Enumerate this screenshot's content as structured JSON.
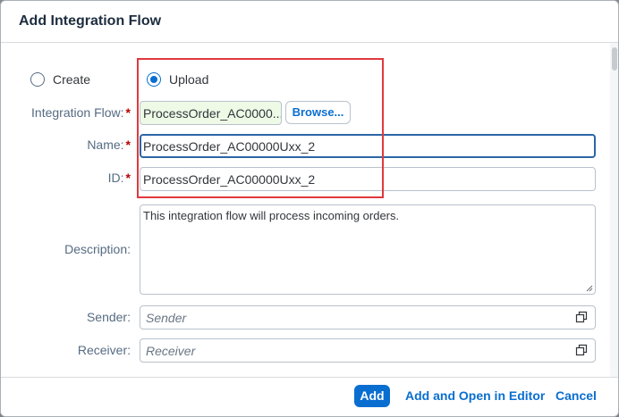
{
  "dialog": {
    "title": "Add Integration Flow"
  },
  "mode": {
    "options": [
      {
        "label": "Create",
        "checked": false
      },
      {
        "label": "Upload",
        "checked": true
      }
    ]
  },
  "form": {
    "integration_flow": {
      "label": "Integration Flow:",
      "required": "*",
      "value": "ProcessOrder_AC0000...",
      "browse_label": "Browse..."
    },
    "name": {
      "label": "Name:",
      "required": "*",
      "value": "ProcessOrder_AC00000Uxx_2"
    },
    "id": {
      "label": "ID:",
      "required": "*",
      "value": "ProcessOrder_AC00000Uxx_2"
    },
    "description": {
      "label": "Description:",
      "value": "This integration flow will process incoming orders."
    },
    "sender": {
      "label": "Sender:",
      "placeholder": "Sender"
    },
    "receiver": {
      "label": "Receiver:",
      "placeholder": "Receiver"
    }
  },
  "footer": {
    "add_label": "Add",
    "add_open_label": "Add and Open in Editor",
    "cancel_label": "Cancel"
  },
  "colors": {
    "accent": "#0a6ed1",
    "required": "#bb0000",
    "highlight": "#e0393e",
    "file_bg": "#eefae6"
  },
  "icons": [
    "value-help-icon",
    "resize-grip-icon"
  ]
}
